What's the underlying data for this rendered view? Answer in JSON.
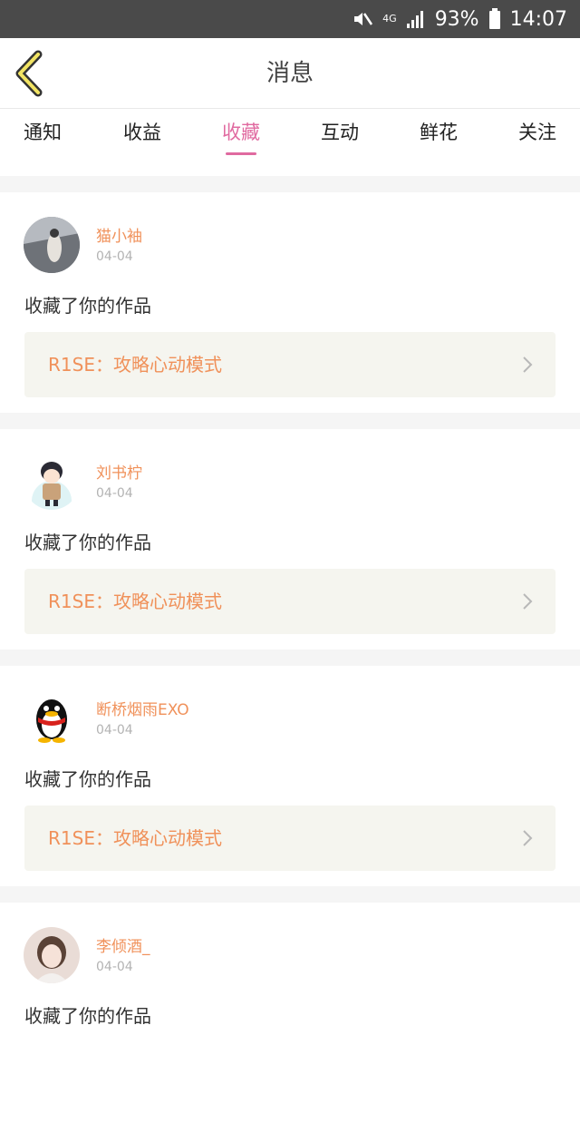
{
  "status_bar": {
    "network": "4G",
    "battery": "93%",
    "time": "14:07",
    "icons": [
      "mute-icon",
      "signal-icon",
      "battery-icon"
    ]
  },
  "header": {
    "title": "消息",
    "back_icon": "chevron-left-icon"
  },
  "tabs": [
    {
      "label": "通知",
      "active": false
    },
    {
      "label": "收益",
      "active": false
    },
    {
      "label": "收藏",
      "active": true
    },
    {
      "label": "互动",
      "active": false
    },
    {
      "label": "鲜花",
      "active": false
    },
    {
      "label": "关注",
      "active": false
    }
  ],
  "colors": {
    "accent": "#e06aa0",
    "name": "#f0915a",
    "card_bg": "#f5f5ef"
  },
  "feed": [
    {
      "user": "猫小袖",
      "date": "04-04",
      "action": "收藏了你的作品",
      "work": "R1SE：攻略心动模式"
    },
    {
      "user": "刘书柠",
      "date": "04-04",
      "action": "收藏了你的作品",
      "work": "R1SE：攻略心动模式"
    },
    {
      "user": "断桥烟雨EXO",
      "date": "04-04",
      "action": "收藏了你的作品",
      "work": "R1SE：攻略心动模式"
    },
    {
      "user": "李倾酒_",
      "date": "04-04",
      "action": "收藏了你的作品",
      "work": ""
    }
  ]
}
